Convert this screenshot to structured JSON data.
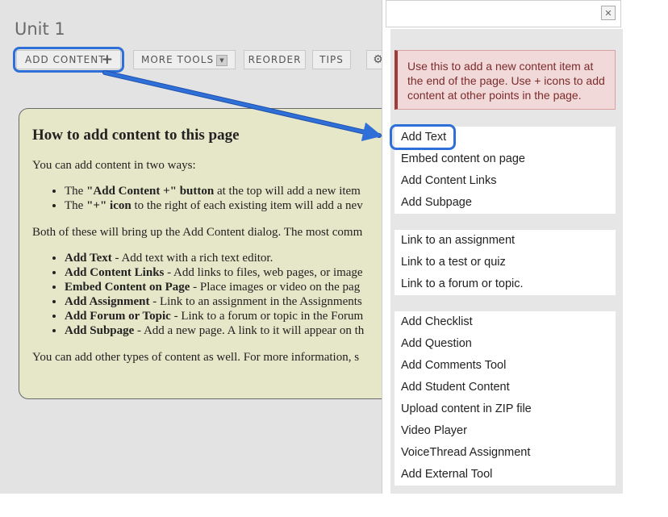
{
  "page": {
    "title": "Unit 1"
  },
  "toolbar": {
    "add_content": "ADD CONTENT",
    "more_tools": "MORE TOOLS",
    "reorder": "REORDER",
    "tips": "TIPS"
  },
  "help": {
    "heading": "How to add content to this page",
    "intro": "You can add content in two ways:",
    "ways": [
      {
        "bold": "\"Add Content +\" button",
        "pre": "The ",
        "rest": " at the top will add a new item"
      },
      {
        "bold": "\"+\" icon",
        "pre": "The ",
        "rest": " to the right of each existing item will add a nev"
      }
    ],
    "both": "Both of these will bring up the Add Content dialog. The most comm",
    "types": [
      {
        "bold": "Add Text",
        "rest": " - Add text with a rich text editor."
      },
      {
        "bold": "Add Content Links",
        "rest": " - Add links to files, web pages, or image"
      },
      {
        "bold": "Embed Content on Page",
        "rest": " - Place images or video on the pag"
      },
      {
        "bold": "Add Assignment",
        "rest": " - Link to an assignment in the Assignments"
      },
      {
        "bold": "Add Forum or Topic",
        "rest": " - Link to a forum or topic in the Forum"
      },
      {
        "bold": "Add Subpage",
        "rest": " - Add a new page. A link to it will appear on th"
      }
    ],
    "more": "You can add other types of content as well. For more information, s"
  },
  "dialog": {
    "close_symbol": "✕",
    "alert": "Use this to add a new content item at the end of the page. Use + icons to add content at other points in the page.",
    "group1": [
      "Add Text",
      "Embed content on page",
      "Add Content Links",
      "Add Subpage"
    ],
    "group2": [
      "Link to an assignment",
      "Link to a test or quiz",
      "Link to a forum or topic."
    ],
    "group3": [
      "Add Checklist",
      "Add Question",
      "Add Comments Tool",
      "Add Student Content",
      "Upload content in ZIP file",
      "Video Player",
      "VoiceThread Assignment",
      "Add External Tool"
    ]
  },
  "colors": {
    "highlight": "#2f6fd8",
    "alert_bg": "#f2d9d9",
    "help_bg": "#e6e6c8"
  }
}
